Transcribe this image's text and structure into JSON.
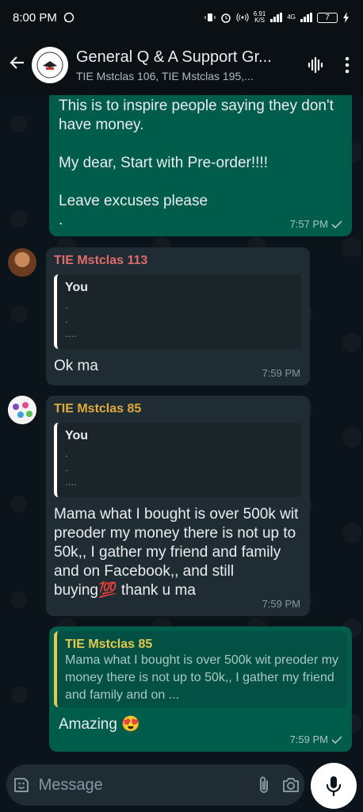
{
  "status_bar": {
    "time": "8:00 PM",
    "net_speed": "6.91",
    "net_unit": "K/S",
    "network": "4G",
    "battery": "7"
  },
  "header": {
    "title": "General Q & A Support Gr...",
    "subtitle": "TIE Mstclas 106, TIE Mstclas 195,..."
  },
  "messages": [
    {
      "type": "outgoing",
      "text": "This is to inspire people saying they don't have money.\n\nMy dear, Start with Pre-order!!!!\n\nLeave excuses please\n.",
      "time": "7:57 PM"
    },
    {
      "type": "incoming",
      "sender": "TIE Mstclas 113",
      "sender_color": "#e06b6b",
      "quote_name": "You",
      "quote_text": ".\n.\n....",
      "text": "Ok ma",
      "time": "7:59 PM"
    },
    {
      "type": "incoming",
      "sender": "TIE Mstclas 85",
      "sender_color": "#e0a93c",
      "quote_name": "You",
      "quote_text": ".\n.\n....",
      "text": "Mama what I bought is over 500k wit preoder my money there is not up to 50k,, I gather my friend and family and on Facebook,, and still buying💯  thank u ma",
      "time": "7:59 PM"
    },
    {
      "type": "outgoing",
      "quote_name": "TIE Mstclas 85",
      "quote_text": "Mama what I bought is over 500k wit preoder my money there is not up to 50k,, I gather my friend and family and on ...",
      "text": "Amazing 😍",
      "time": "7:59 PM"
    }
  ],
  "input": {
    "placeholder": "Message"
  },
  "colors": {
    "outgoing": "#005c4b",
    "incoming": "#202c33",
    "background": "#0b141a"
  }
}
